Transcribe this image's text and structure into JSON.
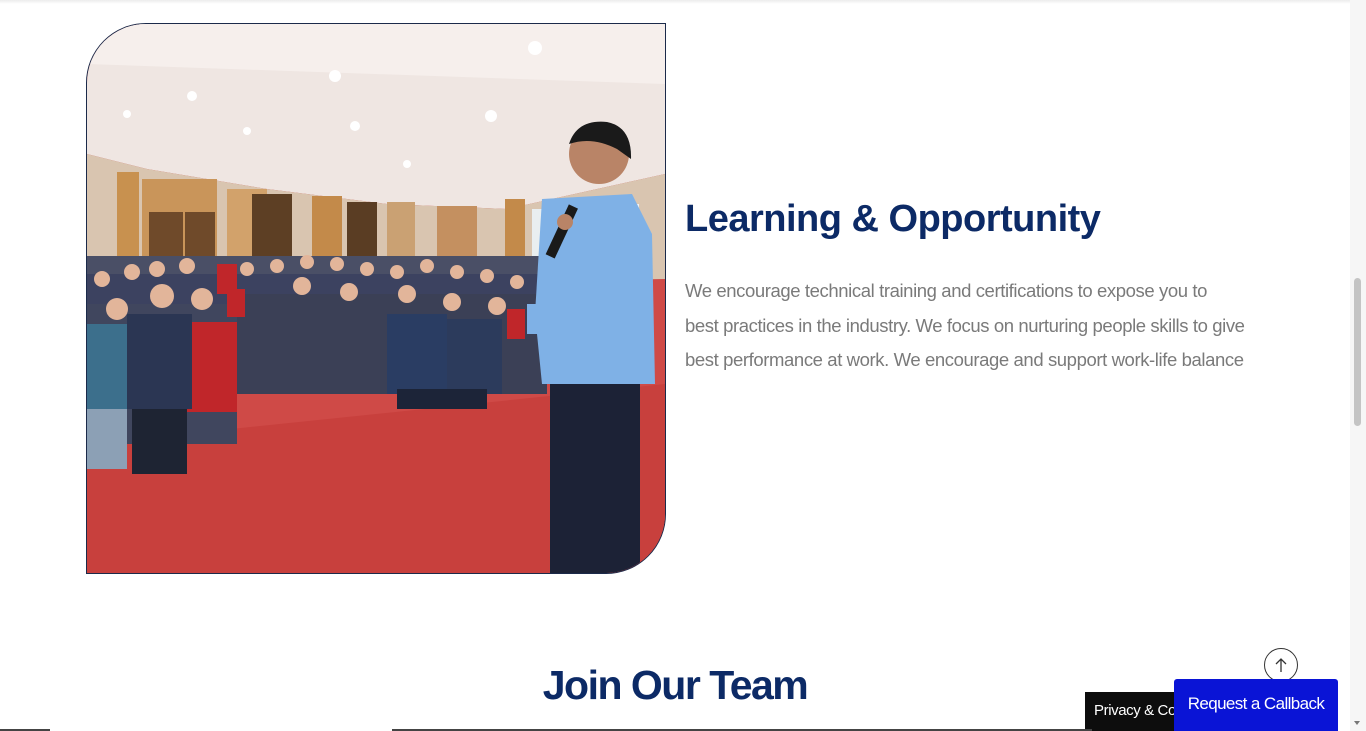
{
  "feature": {
    "image_alt": "Speaker addressing a large audience in an auditorium",
    "title": "Learning & Opportunity",
    "body": "We encourage technical training and certifications to expose you to best practices in the industry. We focus on nurturing people skills to give best performance at work. We encourage and support work-life balance"
  },
  "join_section": {
    "title": "Join Our Team"
  },
  "floating": {
    "back_to_top_icon": "arrow-up-icon",
    "privacy_label": "Privacy & Cookies Policy",
    "callback_label": "Request a Callback"
  },
  "colors": {
    "heading": "#0c2a66",
    "body_text": "#7a7a7a",
    "callback_button": "#0a14d6",
    "privacy_bar": "#0d0d0d"
  }
}
